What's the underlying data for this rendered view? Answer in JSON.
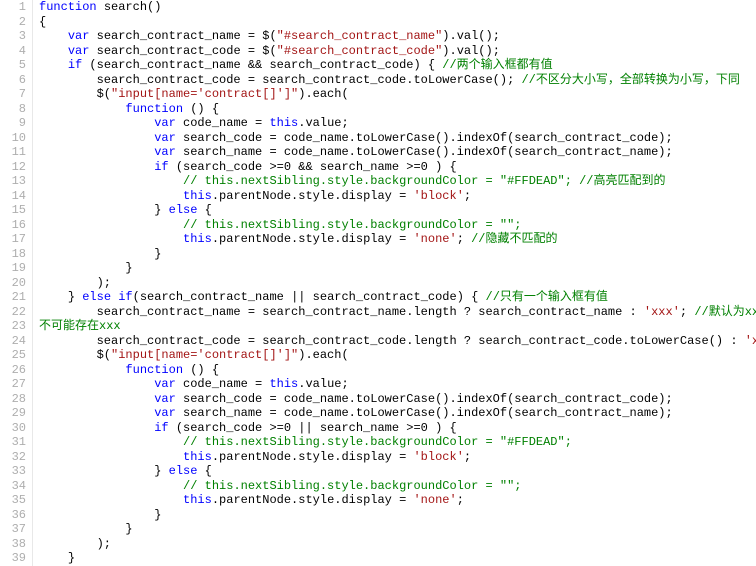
{
  "lines": [
    {
      "n": 1,
      "i": 0,
      "t": [
        [
          "kw",
          "function"
        ],
        [
          "sp",
          " "
        ],
        [
          "fn",
          "search"
        ],
        [
          "punc",
          "()"
        ]
      ]
    },
    {
      "n": 2,
      "i": 0,
      "t": [
        [
          "punc",
          "{"
        ]
      ]
    },
    {
      "n": 3,
      "i": 1,
      "t": [
        [
          "kw",
          "var"
        ],
        [
          "sp",
          " "
        ],
        [
          "var",
          "search_contract_name = $("
        ],
        [
          "str",
          "\"#search_contract_name\""
        ],
        [
          "var",
          ").val();"
        ]
      ]
    },
    {
      "n": 4,
      "i": 1,
      "t": [
        [
          "kw",
          "var"
        ],
        [
          "sp",
          " "
        ],
        [
          "var",
          "search_contract_code = $("
        ],
        [
          "str",
          "\"#search_contract_code\""
        ],
        [
          "var",
          ").val();"
        ]
      ]
    },
    {
      "n": 5,
      "i": 1,
      "t": [
        [
          "kw",
          "if"
        ],
        [
          "sp",
          " "
        ],
        [
          "var",
          "(search_contract_name && search_contract_code) { "
        ],
        [
          "com",
          "//两个输入框都有值"
        ]
      ]
    },
    {
      "n": 6,
      "i": 2,
      "t": [
        [
          "var",
          "search_contract_code = search_contract_code.toLowerCase(); "
        ],
        [
          "com",
          "//不区分大小写，全部转换为小写，下同"
        ]
      ]
    },
    {
      "n": 7,
      "i": 2,
      "t": [
        [
          "var",
          "$("
        ],
        [
          "str",
          "\"input[name='contract[]']\""
        ],
        [
          "var",
          ").each("
        ]
      ]
    },
    {
      "n": 8,
      "i": 3,
      "t": [
        [
          "kw",
          "function"
        ],
        [
          "sp",
          " "
        ],
        [
          "var",
          "() {"
        ]
      ]
    },
    {
      "n": 9,
      "i": 4,
      "t": [
        [
          "kw",
          "var"
        ],
        [
          "sp",
          " "
        ],
        [
          "var",
          "code_name = "
        ],
        [
          "this",
          "this"
        ],
        [
          "var",
          ".value;"
        ]
      ]
    },
    {
      "n": 10,
      "i": 4,
      "t": [
        [
          "kw",
          "var"
        ],
        [
          "sp",
          " "
        ],
        [
          "var",
          "search_code = code_name.toLowerCase().indexOf(search_contract_code);"
        ]
      ]
    },
    {
      "n": 11,
      "i": 4,
      "t": [
        [
          "kw",
          "var"
        ],
        [
          "sp",
          " "
        ],
        [
          "var",
          "search_name = code_name.toLowerCase().indexOf(search_contract_name);"
        ]
      ]
    },
    {
      "n": 12,
      "i": 4,
      "t": [
        [
          "kw",
          "if"
        ],
        [
          "sp",
          " "
        ],
        [
          "var",
          "(search_code >=0 && search_name >=0 ) {"
        ]
      ]
    },
    {
      "n": 13,
      "i": 5,
      "t": [
        [
          "com",
          "// this.nextSibling.style.backgroundColor = \"#FFDEAD\"; //高亮匹配到的"
        ]
      ]
    },
    {
      "n": 14,
      "i": 5,
      "t": [
        [
          "this",
          "this"
        ],
        [
          "var",
          ".parentNode.style.display = "
        ],
        [
          "str",
          "'block'"
        ],
        [
          "var",
          ";"
        ]
      ]
    },
    {
      "n": 15,
      "i": 4,
      "t": [
        [
          "var",
          "} "
        ],
        [
          "kw",
          "else"
        ],
        [
          "sp",
          " "
        ],
        [
          "var",
          "{"
        ]
      ]
    },
    {
      "n": 16,
      "i": 5,
      "t": [
        [
          "com",
          "// this.nextSibling.style.backgroundColor = \"\";"
        ]
      ]
    },
    {
      "n": 17,
      "i": 5,
      "t": [
        [
          "this",
          "this"
        ],
        [
          "var",
          ".parentNode.style.display = "
        ],
        [
          "str",
          "'none'"
        ],
        [
          "var",
          "; "
        ],
        [
          "com",
          "//隐藏不匹配的"
        ]
      ]
    },
    {
      "n": 18,
      "i": 4,
      "t": [
        [
          "var",
          "}"
        ]
      ]
    },
    {
      "n": 19,
      "i": 3,
      "t": [
        [
          "var",
          "}"
        ]
      ]
    },
    {
      "n": 20,
      "i": 2,
      "t": [
        [
          "var",
          ");"
        ]
      ]
    },
    {
      "n": 21,
      "i": 1,
      "t": [
        [
          "var",
          "} "
        ],
        [
          "kw",
          "else if"
        ],
        [
          "var",
          "(search_contract_name || search_contract_code) { "
        ],
        [
          "com",
          "//只有一个输入框有值"
        ]
      ]
    },
    {
      "n": 22,
      "i": 2,
      "t": [
        [
          "var",
          "search_contract_name = search_contract_name.length ? search_contract_name : "
        ],
        [
          "str",
          "'xxx'"
        ],
        [
          "var",
          "; "
        ],
        [
          "com",
          "//默认为xxx是因为"
        ]
      ]
    },
    {
      "n": 23,
      "i": 0,
      "t": [
        [
          "com",
          "不可能存在xxx"
        ]
      ]
    },
    {
      "n": 24,
      "i": 2,
      "t": [
        [
          "var",
          "search_contract_code = search_contract_code.length ? search_contract_code.toLowerCase() : "
        ],
        [
          "str",
          "'xxx'"
        ],
        [
          "var",
          ";"
        ]
      ]
    },
    {
      "n": 25,
      "i": 2,
      "t": [
        [
          "var",
          "$("
        ],
        [
          "str",
          "\"input[name='contract[]']\""
        ],
        [
          "var",
          ").each("
        ]
      ]
    },
    {
      "n": 26,
      "i": 3,
      "t": [
        [
          "kw",
          "function"
        ],
        [
          "sp",
          " "
        ],
        [
          "var",
          "() {"
        ]
      ]
    },
    {
      "n": 27,
      "i": 4,
      "t": [
        [
          "kw",
          "var"
        ],
        [
          "sp",
          " "
        ],
        [
          "var",
          "code_name = "
        ],
        [
          "this",
          "this"
        ],
        [
          "var",
          ".value;"
        ]
      ]
    },
    {
      "n": 28,
      "i": 4,
      "t": [
        [
          "kw",
          "var"
        ],
        [
          "sp",
          " "
        ],
        [
          "var",
          "search_code = code_name.toLowerCase().indexOf(search_contract_code);"
        ]
      ]
    },
    {
      "n": 29,
      "i": 4,
      "t": [
        [
          "kw",
          "var"
        ],
        [
          "sp",
          " "
        ],
        [
          "var",
          "search_name = code_name.toLowerCase().indexOf(search_contract_name);"
        ]
      ]
    },
    {
      "n": 30,
      "i": 4,
      "t": [
        [
          "kw",
          "if"
        ],
        [
          "sp",
          " "
        ],
        [
          "var",
          "(search_code >=0 || search_name >=0 ) {"
        ]
      ]
    },
    {
      "n": 31,
      "i": 5,
      "t": [
        [
          "com",
          "// this.nextSibling.style.backgroundColor = \"#FFDEAD\";"
        ]
      ]
    },
    {
      "n": 32,
      "i": 5,
      "t": [
        [
          "this",
          "this"
        ],
        [
          "var",
          ".parentNode.style.display = "
        ],
        [
          "str",
          "'block'"
        ],
        [
          "var",
          ";"
        ]
      ]
    },
    {
      "n": 33,
      "i": 4,
      "t": [
        [
          "var",
          "} "
        ],
        [
          "kw",
          "else"
        ],
        [
          "sp",
          " "
        ],
        [
          "var",
          "{"
        ]
      ]
    },
    {
      "n": 34,
      "i": 5,
      "t": [
        [
          "com",
          "// this.nextSibling.style.backgroundColor = \"\";"
        ]
      ]
    },
    {
      "n": 35,
      "i": 5,
      "t": [
        [
          "this",
          "this"
        ],
        [
          "var",
          ".parentNode.style.display = "
        ],
        [
          "str",
          "'none'"
        ],
        [
          "var",
          ";"
        ]
      ]
    },
    {
      "n": 36,
      "i": 4,
      "t": [
        [
          "var",
          "}"
        ]
      ]
    },
    {
      "n": 37,
      "i": 3,
      "t": [
        [
          "var",
          "}"
        ]
      ]
    },
    {
      "n": 38,
      "i": 2,
      "t": [
        [
          "var",
          ");"
        ]
      ]
    },
    {
      "n": 39,
      "i": 1,
      "t": [
        [
          "var",
          "}"
        ]
      ]
    }
  ],
  "indentUnit": "    "
}
